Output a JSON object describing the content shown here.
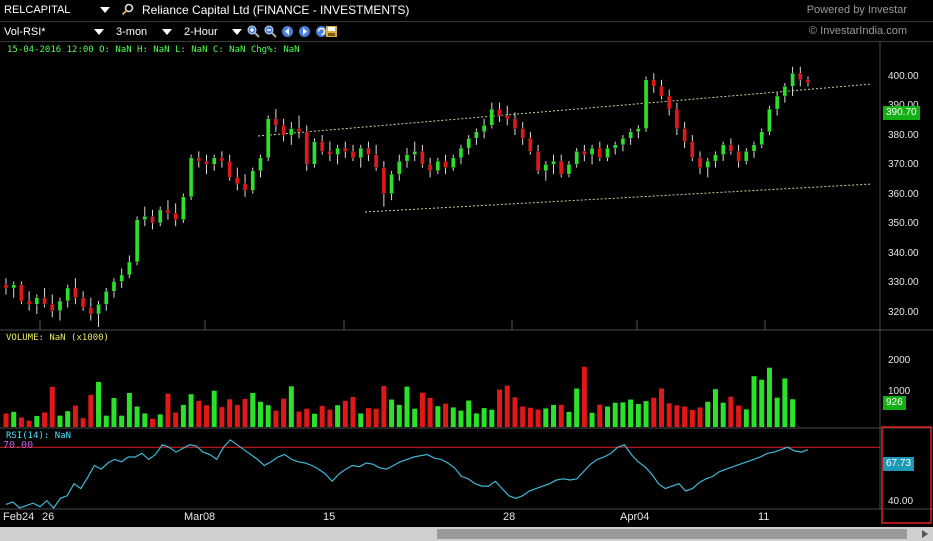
{
  "toolbar": {
    "symbol": "RELCAPITAL",
    "company": "Reliance Capital Ltd  (FINANCE - INVESTMENTS)",
    "powered_by": "Powered by Investar",
    "indicator": "Vol-RSI*",
    "period": "3-mon",
    "interval": "2-Hour",
    "site": "© InvestarIndia.com"
  },
  "ohlc_line": "15-04-2016 12:00  O: NaN  H: NaN  L: NaN  C: NaN  Chg%: NaN",
  "volume_label": "VOLUME: NaN (x1000)",
  "rsi_label": "RSI(14):  NaN",
  "rsi_level_text": "70.00",
  "price_tag": "390.70",
  "volume_tag": "926",
  "rsi_tag": "67.73",
  "colors": {
    "up": "#2be22b",
    "down": "#e01818",
    "rsi": "#3fb8d6",
    "level": "#e02020",
    "channel": "#d0d0a0"
  },
  "chart_data": {
    "type": "candlestick",
    "price_axis": {
      "ticks": [
        "400.00",
        "390.00",
        "380.00",
        "370.00",
        "360.00",
        "350.00",
        "340.00",
        "330.00",
        "320.00"
      ],
      "ylim": [
        315,
        402
      ]
    },
    "volume_axis": {
      "ticks": [
        "2000",
        "1000"
      ]
    },
    "rsi_axis": {
      "ticks": [
        "40.00"
      ],
      "level": 70
    },
    "x_labels": [
      "Feb24",
      "26",
      "Mar08",
      "15",
      "28",
      "Apr04",
      "11"
    ],
    "candles": [
      [
        328,
        330,
        325,
        327
      ],
      [
        327,
        329,
        324,
        328
      ],
      [
        328,
        329,
        322,
        323
      ],
      [
        323,
        326,
        320,
        322
      ],
      [
        322,
        325,
        319,
        324
      ],
      [
        324,
        327,
        321,
        322
      ],
      [
        322,
        325,
        318,
        320
      ],
      [
        320,
        324,
        317,
        323
      ],
      [
        323,
        328,
        321,
        327
      ],
      [
        327,
        330,
        322,
        324
      ],
      [
        324,
        326,
        320,
        321
      ],
      [
        321,
        324,
        317,
        319
      ],
      [
        319,
        323,
        315,
        322
      ],
      [
        322,
        327,
        320,
        326
      ],
      [
        326,
        330,
        324,
        329
      ],
      [
        329,
        333,
        327,
        331
      ],
      [
        331,
        337,
        330,
        335
      ],
      [
        335,
        349,
        334,
        348
      ],
      [
        348,
        352,
        346,
        349
      ],
      [
        349,
        351,
        345,
        347
      ],
      [
        347,
        352,
        346,
        351
      ],
      [
        351,
        354,
        348,
        350
      ],
      [
        350,
        353,
        346,
        348
      ],
      [
        348,
        356,
        347,
        355
      ],
      [
        355,
        368,
        354,
        367
      ],
      [
        367,
        369,
        364,
        366
      ],
      [
        366,
        368,
        362,
        365
      ],
      [
        365,
        368,
        363,
        367
      ],
      [
        367,
        369,
        364,
        366
      ],
      [
        366,
        368,
        360,
        361
      ],
      [
        361,
        364,
        357,
        359
      ],
      [
        359,
        362,
        355,
        357
      ],
      [
        357,
        364,
        356,
        363
      ],
      [
        363,
        368,
        361,
        367
      ],
      [
        367,
        380,
        366,
        379
      ],
      [
        379,
        382,
        375,
        377
      ],
      [
        377,
        379,
        372,
        374
      ],
      [
        374,
        378,
        371,
        376
      ],
      [
        376,
        380,
        373,
        375
      ],
      [
        375,
        377,
        363,
        365
      ],
      [
        365,
        373,
        364,
        372
      ],
      [
        372,
        374,
        368,
        369
      ],
      [
        369,
        372,
        366,
        368
      ],
      [
        368,
        371,
        365,
        370
      ],
      [
        370,
        372,
        367,
        369
      ],
      [
        369,
        371,
        366,
        367
      ],
      [
        367,
        371,
        364,
        370
      ],
      [
        370,
        372,
        366,
        368
      ],
      [
        368,
        371,
        363,
        364
      ],
      [
        364,
        366,
        352,
        356
      ],
      [
        356,
        363,
        354,
        362
      ],
      [
        362,
        368,
        360,
        366
      ],
      [
        366,
        370,
        364,
        368
      ],
      [
        368,
        372,
        366,
        369
      ],
      [
        369,
        371,
        364,
        365
      ],
      [
        365,
        367,
        361,
        363
      ],
      [
        363,
        367,
        362,
        366
      ],
      [
        366,
        368,
        362,
        364
      ],
      [
        364,
        368,
        363,
        367
      ],
      [
        367,
        371,
        365,
        370
      ],
      [
        370,
        374,
        368,
        373
      ],
      [
        373,
        376,
        371,
        375
      ],
      [
        375,
        379,
        373,
        377
      ],
      [
        377,
        384,
        376,
        382
      ],
      [
        382,
        384,
        378,
        380
      ],
      [
        380,
        383,
        377,
        379
      ],
      [
        379,
        381,
        374,
        376
      ],
      [
        376,
        378,
        371,
        373
      ],
      [
        373,
        375,
        368,
        369
      ],
      [
        369,
        371,
        362,
        363
      ],
      [
        363,
        366,
        360,
        365
      ],
      [
        365,
        368,
        362,
        366
      ],
      [
        366,
        368,
        361,
        362
      ],
      [
        362,
        366,
        361,
        365
      ],
      [
        365,
        370,
        364,
        369
      ],
      [
        369,
        371,
        366,
        368
      ],
      [
        368,
        371,
        365,
        370
      ],
      [
        370,
        372,
        366,
        367
      ],
      [
        367,
        371,
        366,
        370
      ],
      [
        370,
        372,
        368,
        371
      ],
      [
        371,
        374,
        369,
        373
      ],
      [
        373,
        376,
        371,
        375
      ],
      [
        375,
        377,
        373,
        376
      ],
      [
        376,
        392,
        375,
        391
      ],
      [
        391,
        393,
        387,
        389
      ],
      [
        389,
        391,
        385,
        386
      ],
      [
        386,
        388,
        380,
        382
      ],
      [
        382,
        384,
        374,
        376
      ],
      [
        376,
        378,
        370,
        372
      ],
      [
        372,
        374,
        366,
        367
      ],
      [
        367,
        369,
        362,
        364
      ],
      [
        364,
        367,
        361,
        366
      ],
      [
        366,
        369,
        364,
        368
      ],
      [
        368,
        372,
        366,
        371
      ],
      [
        371,
        373,
        368,
        369
      ],
      [
        369,
        371,
        364,
        366
      ],
      [
        366,
        370,
        365,
        369
      ],
      [
        369,
        372,
        367,
        371
      ],
      [
        371,
        376,
        370,
        375
      ],
      [
        375,
        383,
        374,
        382
      ],
      [
        382,
        387,
        380,
        386
      ],
      [
        386,
        390,
        384,
        389
      ],
      [
        389,
        395,
        386,
        393
      ],
      [
        393,
        395,
        389,
        391
      ],
      [
        391,
        392,
        389,
        390
      ]
    ],
    "volume": [
      430,
      480,
      300,
      200,
      350,
      460,
      1270,
      360,
      500,
      680,
      280,
      1020,
      1430,
      360,
      920,
      360,
      1080,
      650,
      430,
      260,
      400,
      1060,
      460,
      700,
      1040,
      830,
      690,
      1150,
      630,
      880,
      700,
      890,
      1080,
      800,
      690,
      520,
      900,
      1290,
      490,
      580,
      420,
      670,
      550,
      690,
      830,
      950,
      430,
      600,
      580,
      1300,
      870,
      700,
      1280,
      580,
      1090,
      920,
      660,
      740,
      620,
      520,
      840,
      430,
      600,
      550,
      1190,
      1310,
      940,
      650,
      610,
      550,
      590,
      700,
      700,
      480,
      1220,
      1910,
      450,
      710,
      650,
      770,
      780,
      870,
      730,
      820,
      930,
      1220,
      750,
      690,
      650,
      540,
      620,
      800,
      1200,
      770,
      960,
      680,
      560,
      1610,
      1500,
      1880,
      930,
      1540,
      880
    ],
    "rsi": [
      23,
      25,
      20,
      22,
      24,
      21,
      26,
      20,
      28,
      30,
      40,
      36,
      45,
      55,
      52,
      57,
      60,
      58,
      62,
      62,
      65,
      60,
      64,
      72,
      70,
      66,
      69,
      72,
      71,
      66,
      64,
      60,
      70,
      76,
      72,
      68,
      64,
      60,
      55,
      58,
      62,
      64,
      60,
      58,
      57,
      55,
      52,
      48,
      42,
      48,
      52,
      55,
      54,
      57,
      56,
      53,
      52,
      55,
      58,
      60,
      62,
      63,
      64,
      61,
      60,
      57,
      53,
      46,
      44,
      40,
      38,
      38,
      42,
      36,
      30,
      28,
      30,
      34,
      36,
      38,
      40,
      43,
      44,
      43,
      44,
      50,
      56,
      60,
      62,
      65,
      70,
      72,
      64,
      58,
      54,
      48,
      40,
      36,
      38,
      40,
      34,
      36,
      41,
      44,
      46,
      50,
      52,
      54,
      56,
      58,
      60,
      62,
      65,
      66,
      68,
      70,
      67,
      66,
      68
    ]
  }
}
